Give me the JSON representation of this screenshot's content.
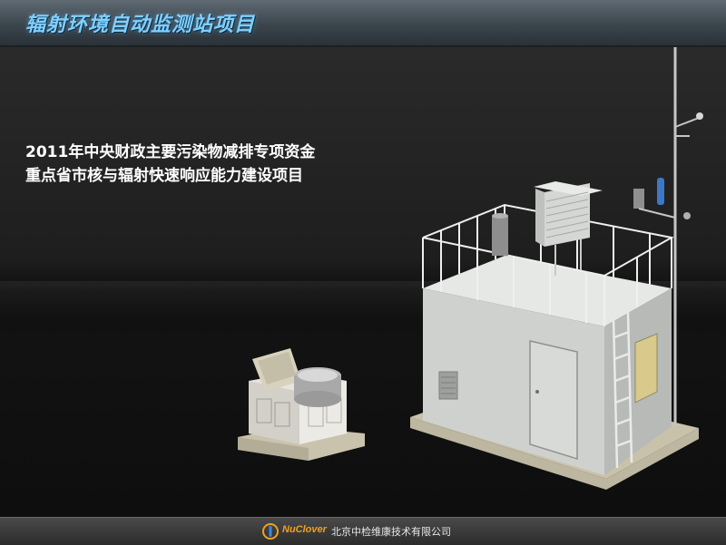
{
  "header": {
    "title": "辐射环境自动监测站项目"
  },
  "content": {
    "headline_line1": "2011年中央财政主要污染物减排专项资金",
    "headline_line2": "重点省市核与辐射快速响应能力建设项目"
  },
  "footer": {
    "brand": "NuClover",
    "company": "北京中检维康技术有限公司"
  },
  "colors": {
    "title_text": "#7fd0ff",
    "brand_orange": "#f0a020",
    "station_body": "#d9dbd8"
  }
}
